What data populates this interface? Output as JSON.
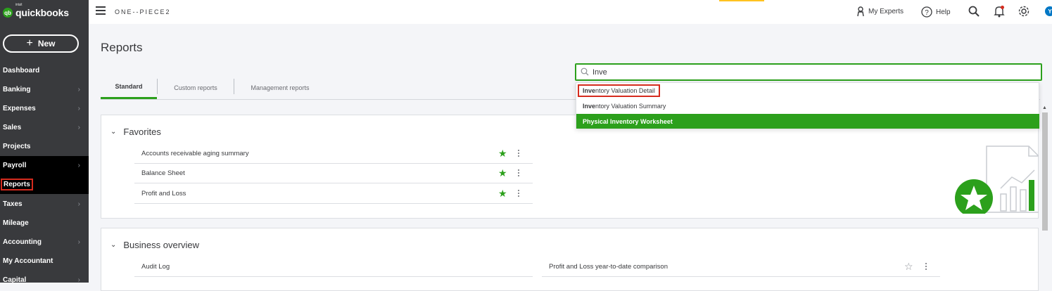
{
  "app": {
    "logo_small": "intuit",
    "logo_text": "quickbooks",
    "logo_mark": "qb"
  },
  "sidebar": {
    "new_label": "New",
    "items": [
      {
        "label": "Dashboard",
        "has_chevron": false
      },
      {
        "label": "Banking",
        "has_chevron": true
      },
      {
        "label": "Expenses",
        "has_chevron": true
      },
      {
        "label": "Sales",
        "has_chevron": true
      },
      {
        "label": "Projects",
        "has_chevron": false
      },
      {
        "label": "Payroll",
        "has_chevron": true
      },
      {
        "label": "Reports",
        "has_chevron": false
      },
      {
        "label": "Taxes",
        "has_chevron": true
      },
      {
        "label": "Mileage",
        "has_chevron": false
      },
      {
        "label": "Accounting",
        "has_chevron": true
      },
      {
        "label": "My Accountant",
        "has_chevron": false
      },
      {
        "label": "Capital",
        "has_chevron": true
      }
    ]
  },
  "header": {
    "company": "ONE--PIECE2",
    "my_experts": "My Experts",
    "help": "Help",
    "avatar_initial": "Y"
  },
  "page": {
    "title": "Reports",
    "tabs": [
      {
        "label": "Standard",
        "active": true
      },
      {
        "label": "Custom reports",
        "active": false
      },
      {
        "label": "Management reports",
        "active": false
      }
    ]
  },
  "search": {
    "value": "Inve",
    "results": [
      {
        "match": "Inve",
        "rest": "ntory Valuation Detail"
      },
      {
        "match": "Inve",
        "rest": "ntory Valuation Summary"
      },
      {
        "match": "",
        "rest": "Physical Inventory Worksheet"
      }
    ]
  },
  "favorites": {
    "title": "Favorites",
    "reports": [
      {
        "label": "Accounts receivable aging summary",
        "starred": true
      },
      {
        "label": "Balance Sheet",
        "starred": true
      },
      {
        "label": "Profit and Loss",
        "starred": true
      }
    ]
  },
  "business_overview": {
    "title": "Business overview",
    "left": [
      {
        "label": "Audit Log",
        "starred": false
      }
    ],
    "right": [
      {
        "label": "Profit and Loss year-to-date comparison",
        "starred": false
      }
    ]
  },
  "colors": {
    "brand_green": "#2ca01c",
    "sidebar_bg": "#393a3d",
    "highlight_red": "#d52b1e",
    "accent_blue": "#0077c5"
  },
  "icons": {
    "menu": "hamburger-icon",
    "experts": "person-icon",
    "help": "question-circle-icon",
    "search": "search-icon",
    "notifications": "bell-icon",
    "settings": "gear-icon",
    "favorite": "star-icon",
    "more": "kebab-icon"
  }
}
